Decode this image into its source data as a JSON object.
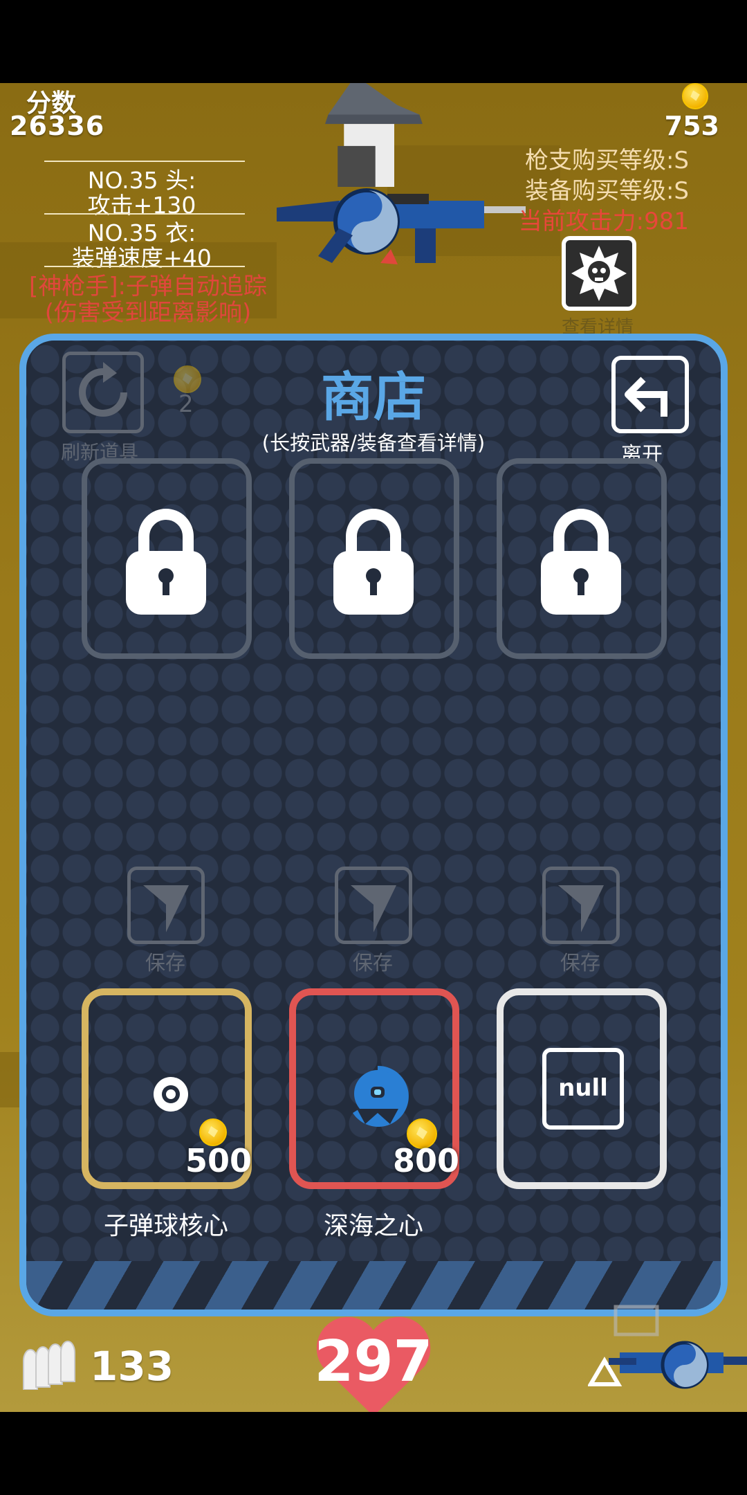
{
  "hud": {
    "score_label": "分数",
    "score_value": "26336",
    "coins": "753",
    "head_equip_title": "NO.35 头:",
    "head_equip_bonus": "攻击+130",
    "body_equip_title": "NO.35 衣:",
    "body_equip_bonus": "装弹速度+40",
    "skill_line1": "[神枪手]:子弹自动追踪",
    "skill_line2": "(伤害受到距离影响)",
    "gun_level": "枪支购买等级:S",
    "equip_level": "装备购买等级:S",
    "attack_power": "当前攻击力:981",
    "details_label": "查看详情",
    "ammo": "133",
    "health": "297"
  },
  "shop": {
    "title": "商店",
    "subtitle": "(长按武器/装备查看详情)",
    "refresh_label": "刷新道具",
    "refresh_cost": "2",
    "leave_label": "离开",
    "save_label": "保存",
    "items": [
      {
        "name": "子弹球核心",
        "price": "500",
        "border_color": "#d6b561"
      },
      {
        "name": "深海之心",
        "price": "800",
        "border_color": "#e05552"
      },
      {
        "name": "",
        "price": "",
        "border_color": "#e8e8e8",
        "icon_text": "null"
      }
    ]
  },
  "colors": {
    "accent_blue": "#5aa7e6",
    "warning_red": "#e0473c",
    "gold": "#f3b400"
  }
}
